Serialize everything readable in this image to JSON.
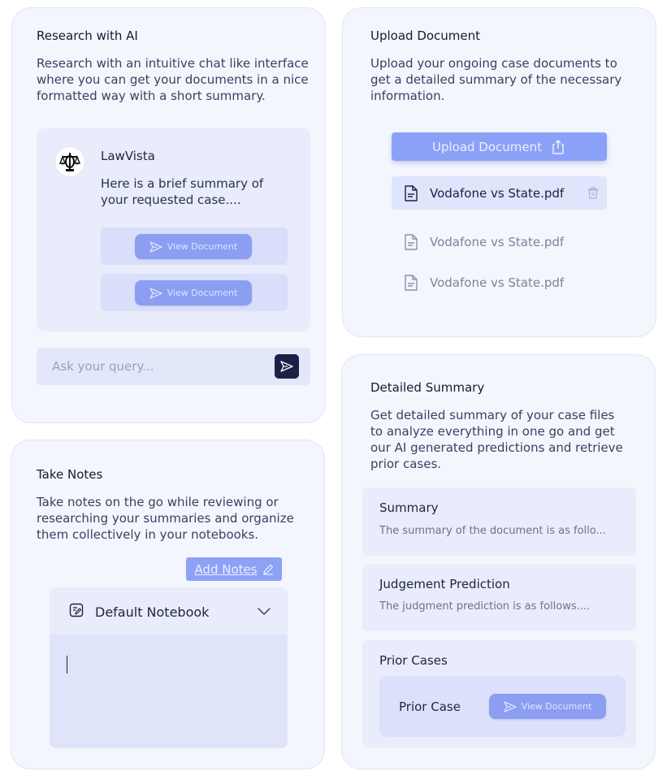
{
  "research": {
    "title": "Research with AI",
    "description": "Research with an intuitive chat like interface where you can get your documents in a nice formatted way with a short summary.",
    "bot_name": "LawVista",
    "bot_message": "Here is a brief summary of your requested case....",
    "view_buttons": [
      "View Document",
      "View Document"
    ],
    "query_placeholder": "Ask your query..."
  },
  "upload": {
    "title": "Upload Document",
    "description": "Upload your ongoing case documents to get a detailed summary of the necessary information.",
    "button_label": "Upload Document",
    "files": [
      "Vodafone vs State.pdf",
      "Vodafone vs State.pdf",
      "Vodafone vs State.pdf"
    ]
  },
  "notes": {
    "title": "Take Notes",
    "description": "Take notes on the go while reviewing or researching your summaries and organize them collectively in your notebooks.",
    "add_label": "Add Notes",
    "notebook_label": "Default Notebook"
  },
  "summary": {
    "title": "Detailed Summary",
    "description": "Get detailed summary of your case files to analyze everything in one go and get our AI generated predictions and retrieve prior cases.",
    "blocks": [
      {
        "title": "Summary",
        "text": "The summary of the document is as follo..."
      },
      {
        "title": "Judgement Prediction",
        "text": "The judgment prediction is as follows...."
      }
    ],
    "prior": {
      "title": "Prior Cases",
      "item_label": "Prior Case",
      "view_label": "View Document"
    }
  },
  "icons": {
    "send": "send-icon",
    "share": "upload-icon",
    "file": "file-icon",
    "trash": "trash-icon",
    "edit": "edit-icon",
    "notebook": "notebook-icon",
    "chevron": "chevron-down-icon",
    "avatar": "scales-of-justice-logo"
  },
  "colors": {
    "accent": "#8ba1f7",
    "dark_button": "#1b2046",
    "card_bg": "#f4f6fd"
  }
}
